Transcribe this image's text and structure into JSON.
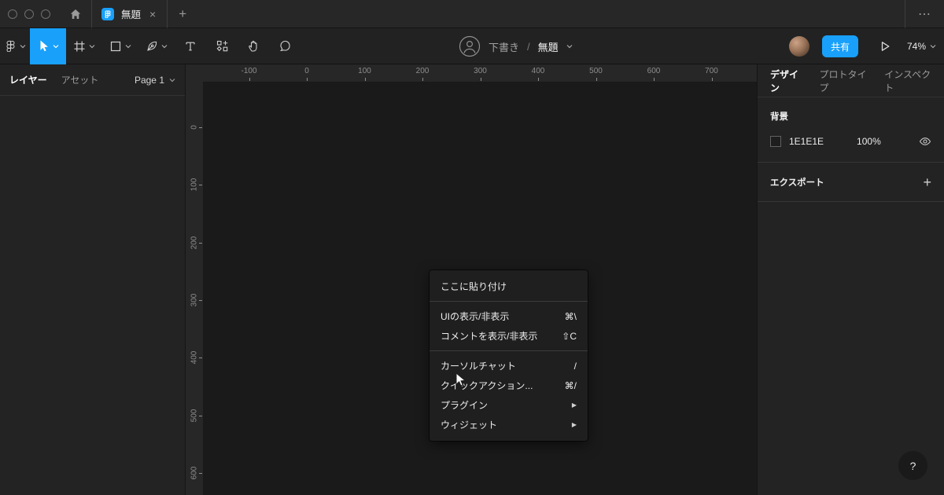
{
  "colors": {
    "accent": "#18a0fb",
    "canvas_background": "#1E1E1E"
  },
  "window_tabs": {
    "tab_title": "無題",
    "close_icon": "×",
    "new_tab_icon": "+",
    "overflow_icon": "⋯"
  },
  "toolbar": {
    "breadcrumb_parent": "下書き",
    "breadcrumb_separator": "/",
    "file_name": "無題",
    "share_label": "共有",
    "zoom_value": "74%"
  },
  "left_panel": {
    "layers_tab": "レイヤー",
    "assets_tab": "アセット",
    "page_selector": "Page 1"
  },
  "right_panel": {
    "design_tab": "デザイン",
    "prototype_tab": "プロトタイプ",
    "inspect_tab": "インスペクト",
    "background": {
      "title": "背景",
      "hex": "1E1E1E",
      "opacity": "100%"
    },
    "export": {
      "title": "エクスポート",
      "add_icon": "+"
    },
    "help_label": "?"
  },
  "rulers": {
    "horizontal": [
      "-100",
      "0",
      "100",
      "200",
      "300",
      "400",
      "500",
      "600",
      "700"
    ],
    "vertical": [
      "0",
      "100",
      "200",
      "300",
      "400",
      "500",
      "600"
    ]
  },
  "context_menu": {
    "items": [
      {
        "type": "item",
        "label": "ここに貼り付け"
      },
      {
        "type": "divider"
      },
      {
        "type": "item",
        "label": "UIの表示/非表示",
        "shortcut": "⌘\\"
      },
      {
        "type": "item",
        "label": "コメントを表示/非表示",
        "shortcut": "⇧C"
      },
      {
        "type": "divider"
      },
      {
        "type": "item",
        "label": "カーソルチャット",
        "shortcut": "/"
      },
      {
        "type": "item",
        "label": "クイックアクション...",
        "shortcut": "⌘/"
      },
      {
        "type": "item",
        "label": "プラグイン",
        "submenu": true
      },
      {
        "type": "item",
        "label": "ウィジェット",
        "submenu": true
      }
    ]
  }
}
